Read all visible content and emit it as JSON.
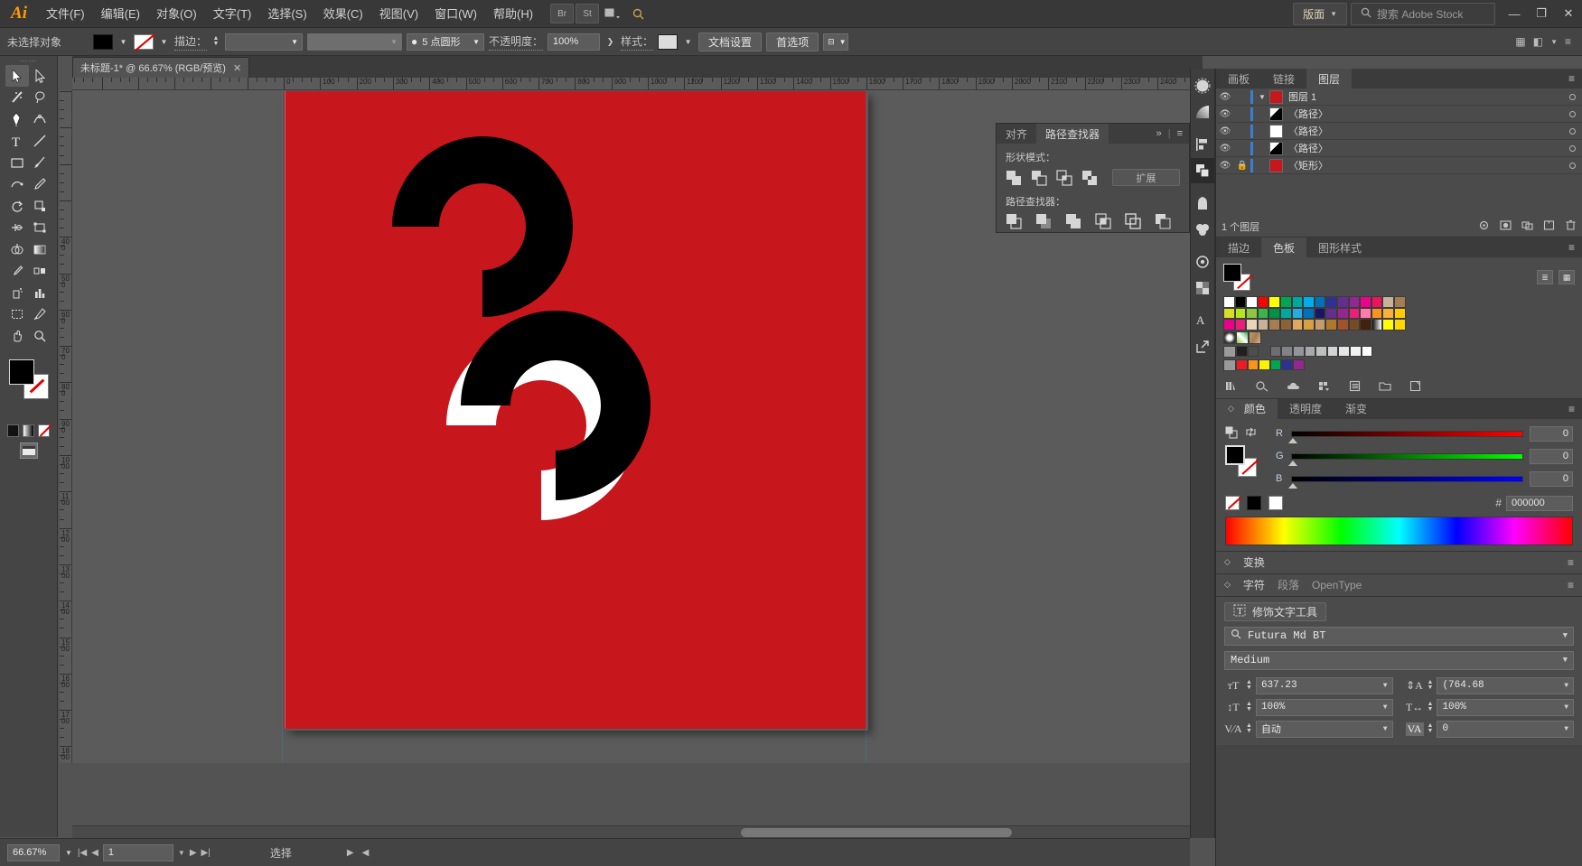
{
  "app": {
    "name": "Adobe Illustrator",
    "logo": "Ai"
  },
  "menubar": {
    "items": [
      {
        "label": "文件(F)",
        "name": "menu-file"
      },
      {
        "label": "编辑(E)",
        "name": "menu-edit"
      },
      {
        "label": "对象(O)",
        "name": "menu-object"
      },
      {
        "label": "文字(T)",
        "name": "menu-type"
      },
      {
        "label": "选择(S)",
        "name": "menu-select"
      },
      {
        "label": "效果(C)",
        "name": "menu-effect"
      },
      {
        "label": "视图(V)",
        "name": "menu-view"
      },
      {
        "label": "窗口(W)",
        "name": "menu-window"
      },
      {
        "label": "帮助(H)",
        "name": "menu-help"
      }
    ],
    "bridge": "Br",
    "stock": "St",
    "workspace": "版面",
    "search_placeholder": "搜索 Adobe Stock",
    "minimize": "—",
    "maximize": "❐",
    "close": "✕"
  },
  "controlbar": {
    "selection_status": "未选择对象",
    "fill_color": "#000000",
    "stroke_color": "none",
    "stroke_label": "描边：",
    "stroke_weight": "",
    "stroke_profile": "",
    "brush_label": "5 点圆形",
    "opacity_label": "不透明度：",
    "opacity_value": "100%",
    "style_label": "样式：",
    "doc_setup": "文档设置",
    "preferences": "首选项"
  },
  "document": {
    "tab_title": "未标题-1* @ 66.67% (RGB/预览)",
    "close_glyph": "✕"
  },
  "toolbar": {
    "tools": [
      "selection-tool",
      "direct-selection-tool",
      "magic-wand-tool",
      "lasso-tool",
      "pen-tool",
      "curvature-tool",
      "type-tool",
      "line-segment-tool",
      "rectangle-tool",
      "paintbrush-tool",
      "shaper-tool",
      "pencil-tool",
      "rotate-tool",
      "scale-tool",
      "width-tool",
      "free-transform-tool",
      "shape-builder-tool",
      "gradient-tool",
      "eyedropper-tool",
      "blend-tool",
      "symbol-sprayer-tool",
      "column-graph-tool",
      "artboard-tool",
      "slice-tool",
      "hand-tool",
      "zoom-tool"
    ],
    "fill_color": "#000000",
    "stroke_color": "#ffffff"
  },
  "rulers": {
    "horizontal_unit_labels": [
      "0",
      "100",
      "200",
      "300",
      "400",
      "500",
      "600",
      "700",
      "800",
      "900",
      "1000",
      "1100",
      "1200",
      "1300",
      "1400",
      "1500",
      "1600"
    ],
    "vertical_unit_labels": [
      "400",
      "500",
      "600",
      "700",
      "800",
      "900",
      "1000",
      "1100",
      "1200",
      "1300",
      "1400",
      "1500"
    ]
  },
  "canvas": {
    "artboard_color": "#C8161D",
    "shape_black": "#000000",
    "shape_white": "#FFFFFF"
  },
  "pathfinder": {
    "tabs": [
      {
        "label": "对齐",
        "active": false,
        "name": "tab-align"
      },
      {
        "label": "路径查找器",
        "active": true,
        "name": "tab-pathfinder"
      }
    ],
    "collapse_glyph": "»",
    "menu_glyph": "≡",
    "shape_modes_label": "形状模式：",
    "pathfinders_label": "路径查找器：",
    "expand_label": "扩展",
    "shape_modes": [
      "unite-icon",
      "minus-front-icon",
      "intersect-icon",
      "exclude-icon"
    ],
    "pathfinders": [
      "divide-icon",
      "trim-icon",
      "merge-icon",
      "crop-icon",
      "outline-icon",
      "minus-back-icon"
    ]
  },
  "icon_rail": {
    "icons": [
      "brushes-icon",
      "gradient-icon",
      "align-icon",
      "pathfinder-icon",
      "symbols-icon",
      "graphic-styles-icon",
      "appearance-icon",
      "transparency-icon",
      "artboards-icon",
      "asset-export-icon"
    ]
  },
  "dock": {
    "top_tabs": [
      {
        "label": "画板",
        "active": false,
        "name": "tab-artboards"
      },
      {
        "label": "链接",
        "active": false,
        "name": "tab-links"
      },
      {
        "label": "图层",
        "active": true,
        "name": "tab-layers"
      }
    ],
    "layers": {
      "rows": [
        {
          "name": "图层 1",
          "type": "layer",
          "thumb": "#C8161D",
          "locked": false,
          "expanded": true,
          "selected": false,
          "indent": 0
        },
        {
          "name": "〈路径〉",
          "type": "path",
          "thumb": "gradient",
          "locked": false,
          "expanded": false,
          "selected": false,
          "indent": 1
        },
        {
          "name": "〈路径〉",
          "type": "path",
          "thumb": "#ffffff",
          "locked": false,
          "expanded": false,
          "selected": false,
          "indent": 1
        },
        {
          "name": "〈路径〉",
          "type": "path",
          "thumb": "gradient",
          "locked": false,
          "expanded": false,
          "selected": false,
          "indent": 1
        },
        {
          "name": "〈矩形〉",
          "type": "rect",
          "thumb": "#C8161D",
          "locked": true,
          "expanded": false,
          "selected": false,
          "indent": 1
        }
      ],
      "footer_count": "1 个图层",
      "footer_icons": [
        "locate-object-icon",
        "make-mask-icon",
        "create-sublayer-icon",
        "new-layer-icon",
        "delete-layer-icon"
      ]
    },
    "swatch_tabs": [
      {
        "label": "描边",
        "active": false,
        "name": "tab-stroke"
      },
      {
        "label": "色板",
        "active": true,
        "name": "tab-swatches"
      },
      {
        "label": "图形样式",
        "active": false,
        "name": "tab-graphic-styles"
      }
    ],
    "swatches": {
      "rows": [
        [
          "#ffffff",
          "#000000",
          "#ffffff",
          "#ff0000",
          "#ffff00",
          "#00a651",
          "#00a2e8",
          "#0000ff",
          "#a349a4",
          "#ff00ff",
          "#ff7f27",
          "#ffaec9",
          "#b97a57",
          "#c3c3c3",
          "#7f7f7f",
          "#880015",
          "#ed1c24",
          "#ff7f27"
        ],
        [
          "#ffd800",
          "#b5e61d",
          "#99d9ea",
          "#22b14c",
          "#00a99d",
          "#3f48cc",
          "#7092be",
          "#c8bfe7",
          "#fff200",
          "#efe4b0",
          "#b5e61d",
          "#c6df8e",
          "#ece5c3",
          "#e5c89a",
          "#d4aa70",
          "#a67c52",
          "#8c6239",
          "#ffffff"
        ],
        [
          "#ec008c",
          "#ec2089",
          "#e8d6b9",
          "#c0a080",
          "#a88a68",
          "#8b6f47",
          "#e8b46a",
          "#d99c3f",
          "#c68b2e",
          "#b0782a",
          "#8a5a20",
          "#6b4419",
          "#ffffff",
          "#ffd800",
          "#ff00ff",
          "#8a5a20",
          "#ffffff",
          "#ffd800"
        ],
        [
          "pattern-dot",
          "pattern-leaf",
          "pattern-texture"
        ],
        [
          "folder",
          "#231f20",
          "#4d4d4d",
          "#6d6e71",
          "#808285",
          "#939598",
          "#a7a9ac",
          "#bcbec0",
          "#d1d3d4",
          "#e6e7e8",
          "#f1f2f2",
          "#ffffff"
        ],
        [
          "folder",
          "#ed1c24",
          "#f7941e",
          "#fff200",
          "#00a651",
          "#2e3192",
          "#92278f"
        ]
      ],
      "footer_icons": [
        "swatch-libraries-icon",
        "color-groups-icon",
        "color-themes-icon",
        "show-kinds-icon",
        "options-icon",
        "new-group-icon",
        "new-swatch-icon",
        "delete-swatch-icon"
      ]
    },
    "color_tabs": [
      {
        "label": "颜色",
        "active": true,
        "name": "tab-color"
      },
      {
        "label": "透明度",
        "active": false,
        "name": "tab-transparency"
      },
      {
        "label": "渐变",
        "active": false,
        "name": "tab-gradient"
      }
    ],
    "color": {
      "mode": "RGB",
      "channels": [
        {
          "label": "R",
          "value": "0",
          "track_color": "#ff0000"
        },
        {
          "label": "G",
          "value": "0",
          "track_color": "#00ff00"
        },
        {
          "label": "B",
          "value": "0",
          "track_color": "#0000ff"
        }
      ],
      "hex_prefix": "#",
      "hex_value": "000000",
      "fill": "#000000"
    },
    "transform": {
      "label": "变换",
      "triangle": "◇"
    },
    "character_tabs": [
      {
        "label": "字符",
        "active": true,
        "name": "tab-character"
      },
      {
        "label": "段落",
        "active": false,
        "name": "tab-paragraph"
      },
      {
        "label": "OpenType",
        "active": false,
        "name": "tab-opentype"
      }
    ],
    "character": {
      "touch_type_label": "修饰文字工具",
      "font_family": "Futura Md BT",
      "font_style": "Medium",
      "font_size": "637.23",
      "leading": "(764.68",
      "vertical_scale": "100%",
      "horizontal_scale": "100%",
      "kerning": "自动",
      "tracking": "0",
      "icons": {
        "size": "font-size-icon",
        "leading": "leading-icon",
        "vscale": "vertical-scale-icon",
        "hscale": "horizontal-scale-icon",
        "kerning": "kerning-icon",
        "tracking": "tracking-icon"
      }
    }
  },
  "statusbar": {
    "zoom": "66.67%",
    "artboard_number": "1",
    "current_tool": "选择",
    "nav_first": "|◀",
    "nav_prev": "◀",
    "nav_next": "▶",
    "nav_last": "▶|",
    "right_arrow": "▶",
    "left_arrow": "◀"
  }
}
